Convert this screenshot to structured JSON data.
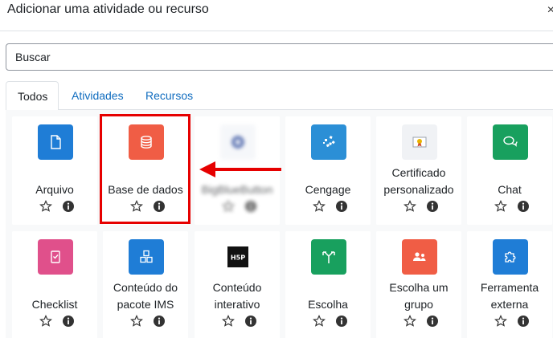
{
  "modal": {
    "title": "Adicionar uma atividade ou recurso",
    "close_glyph": "×"
  },
  "search": {
    "placeholder": "Buscar"
  },
  "tabs": [
    {
      "label": "Todos"
    },
    {
      "label": "Atividades"
    },
    {
      "label": "Recursos"
    }
  ],
  "colors": {
    "accent": "#0f6cbf",
    "highlight": "#e60000"
  },
  "cards": [
    {
      "line1": "Arquivo",
      "line2": "",
      "icon": "file-icon",
      "color": "#1f7dd6"
    },
    {
      "line1": "Base de dados",
      "line2": "",
      "icon": "database-icon",
      "color": "#f05d45"
    },
    {
      "line1": "BigBlueButton",
      "line2": "",
      "icon": "bigbluebutton-icon",
      "color": "#2d4b9c"
    },
    {
      "line1": "Cengage",
      "line2": "",
      "icon": "cengage-icon",
      "color": "#2b8fd6"
    },
    {
      "line1": "Certificado",
      "line2": "personalizado",
      "icon": "certificate-icon",
      "color": "#f0f0f0"
    },
    {
      "line1": "Chat",
      "line2": "",
      "icon": "chat-icon",
      "color": "#18a05e"
    },
    {
      "line1": "Checklist",
      "line2": "",
      "icon": "checklist-icon",
      "color": "#e0508b"
    },
    {
      "line1": "Conteúdo do",
      "line2": "pacote IMS",
      "icon": "ims-package-icon",
      "color": "#1f7dd6"
    },
    {
      "line1": "Conteúdo",
      "line2": "interativo",
      "icon": "h5p-icon",
      "color": "#111111"
    },
    {
      "line1": "Escolha",
      "line2": "",
      "icon": "choice-icon",
      "color": "#18a05e"
    },
    {
      "line1": "Escolha um",
      "line2": "grupo",
      "icon": "group-choice-icon",
      "color": "#f05d45"
    },
    {
      "line1": "Ferramenta",
      "line2": "externa",
      "icon": "puzzle-icon",
      "color": "#1f7dd6"
    }
  ],
  "card_actions": {
    "star_icon": "star-outline-icon",
    "info_icon": "info-icon"
  },
  "annotation": {
    "arrow_icon": "red-arrow-left-icon"
  }
}
